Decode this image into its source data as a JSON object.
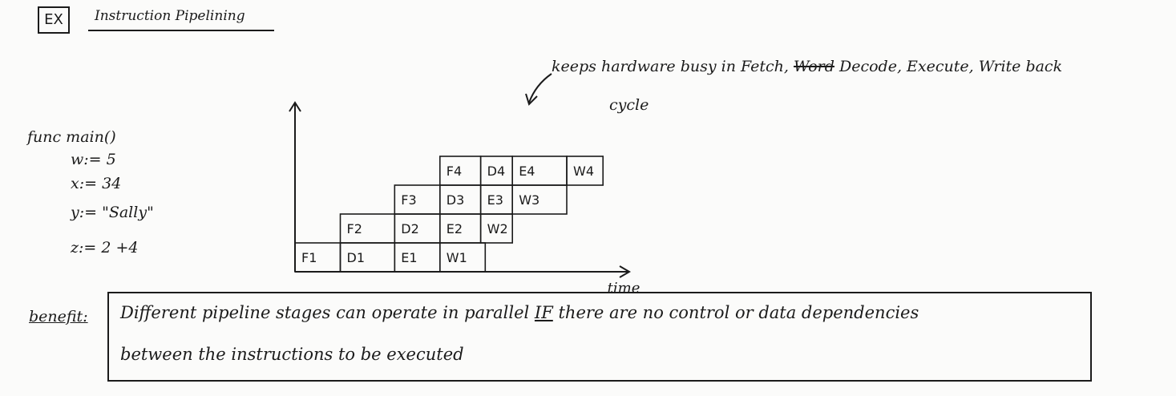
{
  "header": {
    "ex_label": "EX",
    "title": "Instruction Pipelining"
  },
  "annotation": {
    "line1_prefix": "keeps hardware busy in Fetch,",
    "line1_scribble": "Word",
    "line1_suffix": "Decode, Execute, Write back",
    "line2": "cycle"
  },
  "code": {
    "func": "func main()",
    "lines": [
      "w:= 5",
      "x:= 34",
      "y:= \"Sally\"",
      "z:= 2 +4"
    ]
  },
  "chart_data": {
    "type": "table",
    "title": "",
    "xlabel": "time",
    "ylabel": "",
    "stages": [
      "F",
      "D",
      "E",
      "W"
    ],
    "instructions": [
      {
        "row": 1,
        "cells": [
          {
            "label": "F1",
            "start": 0,
            "end": 1
          },
          {
            "label": "D1",
            "start": 1,
            "end": 2.2
          },
          {
            "label": "E1",
            "start": 2.2,
            "end": 3.2
          },
          {
            "label": "W1",
            "start": 3.2,
            "end": 4.2
          }
        ]
      },
      {
        "row": 2,
        "cells": [
          {
            "label": "F2",
            "start": 1,
            "end": 2.2
          },
          {
            "label": "D2",
            "start": 2.2,
            "end": 3.2
          },
          {
            "label": "E2",
            "start": 3.2,
            "end": 4.1
          },
          {
            "label": "W2",
            "start": 4.1,
            "end": 4.8
          }
        ]
      },
      {
        "row": 3,
        "cells": [
          {
            "label": "F3",
            "start": 2.2,
            "end": 3.2
          },
          {
            "label": "D3",
            "start": 3.2,
            "end": 4.1
          },
          {
            "label": "E3",
            "start": 4.1,
            "end": 4.8
          },
          {
            "label": "W3",
            "start": 4.8,
            "end": 6.0
          }
        ]
      },
      {
        "row": 4,
        "cells": [
          {
            "label": "F4",
            "start": 3.2,
            "end": 4.1
          },
          {
            "label": "D4",
            "start": 4.1,
            "end": 4.8
          },
          {
            "label": "E4",
            "start": 4.8,
            "end": 6.0
          },
          {
            "label": "W4",
            "start": 6.0,
            "end": 6.8
          }
        ]
      }
    ]
  },
  "benefit": {
    "label": "benefit:",
    "line1_pre": "Different pipeline stages can operate in parallel",
    "line1_if": "IF",
    "line1_post": "there are no control or data dependencies",
    "line2": "between the instructions to be executed"
  }
}
